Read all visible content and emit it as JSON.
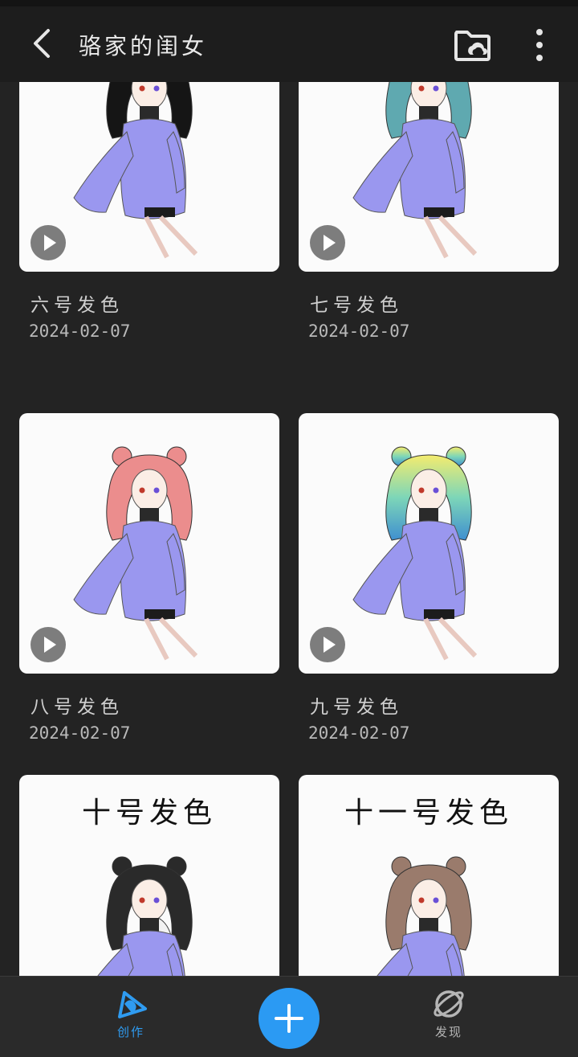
{
  "header": {
    "title": "骆家的闺女",
    "back_icon": "back-arrow-icon",
    "folder_icon": "folder-cloud-icon",
    "more_icon": "more-vertical-icon"
  },
  "artworks": [
    {
      "title": "六号发色",
      "date": "2024-02-07",
      "hair_color": "#151515",
      "overlay_text": "",
      "has_play": true
    },
    {
      "title": "七号发色",
      "date": "2024-02-07",
      "hair_color": "#5fa9b0",
      "overlay_text": "",
      "has_play": true
    },
    {
      "title": "八号发色",
      "date": "2024-02-07",
      "hair_color": "#eb8d8d",
      "overlay_text": "",
      "has_play": true
    },
    {
      "title": "九号发色",
      "date": "2024-02-07",
      "hair_color": "#7fd0c8",
      "hair_gradient": [
        "#f4ec6e",
        "#7dd6b8",
        "#3f8fd0"
      ],
      "overlay_text": "",
      "has_play": true
    },
    {
      "title": "",
      "date": "",
      "hair_color": "#2a2a2a",
      "hair_split": "#f2f2f2",
      "overlay_text": "十号发色",
      "has_play": false
    },
    {
      "title": "",
      "date": "",
      "hair_color": "#9a7b6c",
      "overlay_text": "十一号发色",
      "has_play": false
    }
  ],
  "colors": {
    "background": "#232323",
    "accent": "#2b9af3",
    "sweater": "#9a97ef"
  },
  "bottom_nav": {
    "create_label": "创作",
    "discover_label": "发现",
    "create_icon": "create-pen-icon",
    "add_icon": "plus-icon",
    "discover_icon": "planet-icon"
  }
}
